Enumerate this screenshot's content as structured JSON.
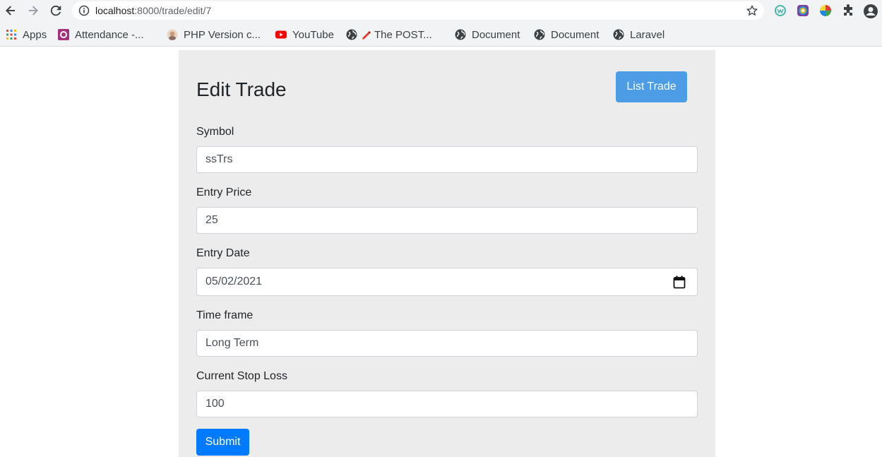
{
  "browser": {
    "url_host": "localhost",
    "url_rest": ":8000/trade/edit/7",
    "bookmarks": [
      {
        "label": "Apps",
        "icon": "apps-grid-icon"
      },
      {
        "label": "Attendance -...",
        "icon": "attendance-icon"
      },
      {
        "label": "PHP Version c...",
        "icon": "php-icon"
      },
      {
        "label": "YouTube",
        "icon": "youtube-icon"
      },
      {
        "label": "The POST...",
        "icon": "postman-icon"
      },
      {
        "label": "Document",
        "icon": "globe-icon"
      },
      {
        "label": "Document",
        "icon": "globe-icon"
      },
      {
        "label": "Laravel",
        "icon": "globe-icon"
      }
    ]
  },
  "page": {
    "title": "Edit Trade",
    "list_button": "List Trade",
    "submit_button": "Submit"
  },
  "form": {
    "fields": [
      {
        "label": "Symbol",
        "value": "ssTrs"
      },
      {
        "label": "Entry Price",
        "value": "25"
      },
      {
        "label": "Entry Date",
        "value": "05/02/2021"
      },
      {
        "label": "Time frame",
        "value": "Long Term"
      },
      {
        "label": "Current Stop Loss",
        "value": "100"
      }
    ]
  },
  "colors": {
    "list_button": "#4d9de6",
    "submit_button": "#007bff",
    "card_background": "#ececec"
  }
}
